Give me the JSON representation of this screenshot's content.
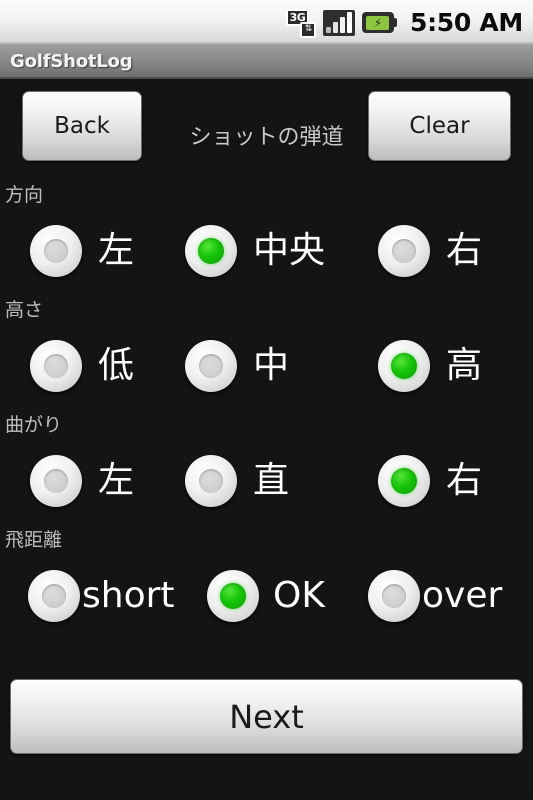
{
  "status_bar": {
    "network_icon": "3g-icon",
    "network_label": "3G",
    "network_arrows": "⇅",
    "signal_icon": "signal-bars-icon",
    "battery_icon": "battery-charging-icon",
    "battery_bolt": "⚡",
    "time": "5:50 AM"
  },
  "title_bar": {
    "app_title": "GolfShotLog"
  },
  "toolbar": {
    "back_label": "Back",
    "clear_label": "Clear",
    "subtitle": "ショットの弾道"
  },
  "groups": [
    {
      "name": "direction",
      "label": "方向",
      "options": [
        {
          "label": "左",
          "checked": false
        },
        {
          "label": "中央",
          "checked": true
        },
        {
          "label": "右",
          "checked": false
        }
      ]
    },
    {
      "name": "height",
      "label": "高さ",
      "options": [
        {
          "label": "低",
          "checked": false
        },
        {
          "label": "中",
          "checked": false
        },
        {
          "label": "高",
          "checked": true
        }
      ]
    },
    {
      "name": "curve",
      "label": "曲がり",
      "options": [
        {
          "label": "左",
          "checked": false
        },
        {
          "label": "直",
          "checked": false
        },
        {
          "label": "右",
          "checked": true
        }
      ]
    },
    {
      "name": "distance",
      "label": "飛距離",
      "options": [
        {
          "label": "short",
          "checked": false
        },
        {
          "label": "OK",
          "checked": true
        },
        {
          "label": "over",
          "checked": false
        }
      ]
    }
  ],
  "footer": {
    "next_label": "Next"
  },
  "colors": {
    "background": "#141414",
    "accent_green": "#16c409",
    "title_bar": "#8c8c8c",
    "button_face": "#e8e8e8",
    "label_gray": "#bdbdbd"
  }
}
